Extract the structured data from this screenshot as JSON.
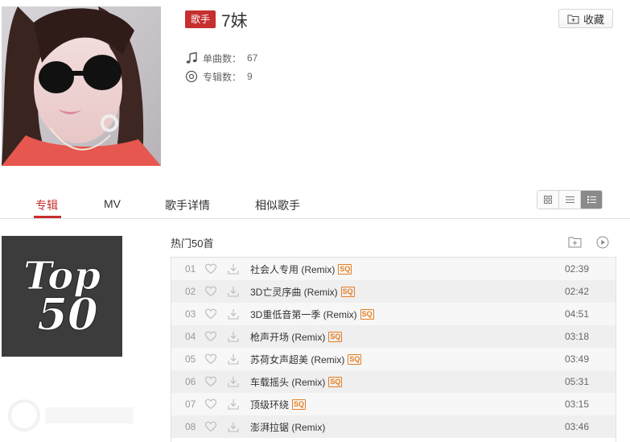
{
  "header": {
    "badge": "歌手",
    "artist_name": "7妹",
    "fav_label": "收藏",
    "stats": [
      {
        "label": "单曲数：",
        "value": "67",
        "icon": "music-note-icon"
      },
      {
        "label": "专辑数：",
        "value": "9",
        "icon": "disc-icon"
      }
    ]
  },
  "tabs": [
    {
      "label": "专辑",
      "active": true
    },
    {
      "label": "MV"
    },
    {
      "label": "歌手详情"
    },
    {
      "label": "相似歌手"
    }
  ],
  "album": {
    "cover_text_1": "Top",
    "cover_text_2": "50",
    "list_title": "热门50首"
  },
  "songs": [
    {
      "index": "01",
      "title": "社会人专用 (Remix)",
      "sq": true,
      "duration": "02:39"
    },
    {
      "index": "02",
      "title": "3D亡灵序曲 (Remix)",
      "sq": true,
      "duration": "02:42"
    },
    {
      "index": "03",
      "title": "3D重低音第一季 (Remix)",
      "sq": true,
      "duration": "04:51"
    },
    {
      "index": "04",
      "title": "枪声开场 (Remix)",
      "sq": true,
      "duration": "03:18"
    },
    {
      "index": "05",
      "title": "苏荷女声超美 (Remix)",
      "sq": true,
      "duration": "03:49"
    },
    {
      "index": "06",
      "title": "车载摇头 (Remix)",
      "sq": true,
      "duration": "05:31"
    },
    {
      "index": "07",
      "title": "顶级环绕",
      "sq": true,
      "duration": "03:15"
    },
    {
      "index": "08",
      "title": "澎湃拉锯 (Remix)",
      "sq": false,
      "duration": "03:46"
    }
  ],
  "sq_label": "SQ",
  "colors": {
    "accent": "#c62f2f",
    "sq": "#e67e22"
  }
}
